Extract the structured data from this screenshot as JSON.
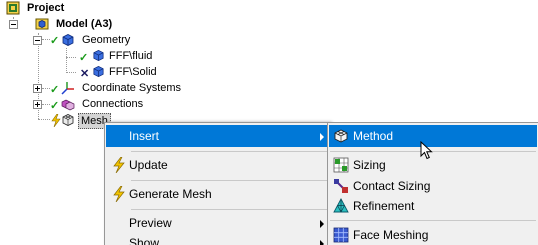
{
  "tree": {
    "project": "Project",
    "model": "Model (A3)",
    "geometry": "Geometry",
    "fluid": "FFF\\fluid",
    "solid": "FFF\\Solid",
    "coordinate_systems": "Coordinate Systems",
    "connections": "Connections",
    "mesh": "Mesh"
  },
  "context_menu": {
    "insert": "Insert",
    "update": "Update",
    "generate_mesh": "Generate Mesh",
    "preview": "Preview",
    "show": "Show"
  },
  "insert_submenu": {
    "method": "Method",
    "sizing": "Sizing",
    "contact_sizing": "Contact Sizing",
    "refinement": "Refinement",
    "face_meshing": "Face Meshing"
  },
  "colors": {
    "highlight": "#0078d7",
    "check": "#1a9a1a",
    "lightning": "#f2c400"
  },
  "icons": {
    "project": "project-icon",
    "model": "model-icon",
    "geometry": "geometry-icon",
    "body": "body-icon",
    "coordinate_systems": "axes-icon",
    "connections": "connections-icon",
    "mesh": "mesh-icon",
    "update": "lightning-icon",
    "generate_mesh": "lightning-icon",
    "method": "method-icon",
    "sizing": "sizing-icon",
    "contact_sizing": "contact-sizing-icon",
    "refinement": "refinement-icon",
    "face_meshing": "face-meshing-icon",
    "cursor": "mouse-cursor-icon"
  }
}
